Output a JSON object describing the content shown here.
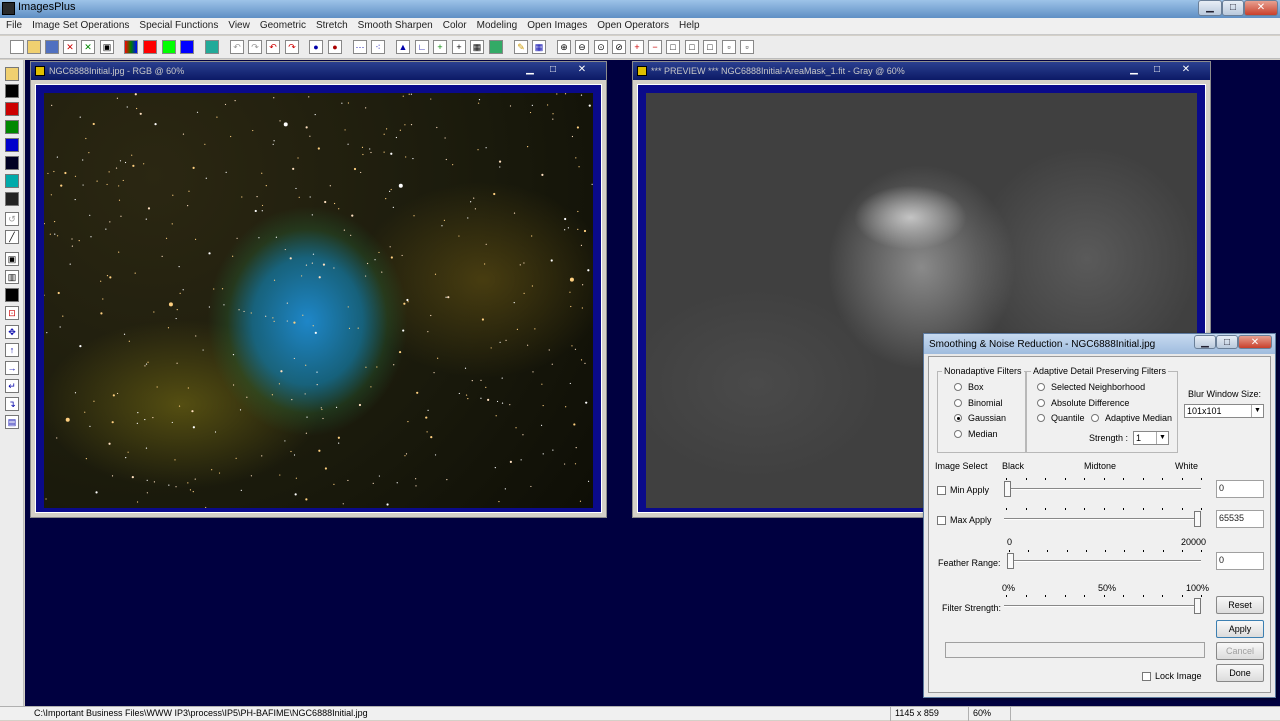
{
  "app": {
    "title": "ImagesPlus"
  },
  "menu": [
    "File",
    "Image Set Operations",
    "Special Functions",
    "View",
    "Geometric",
    "Stretch",
    "Smooth Sharpen",
    "Color",
    "Modeling",
    "Open Images",
    "Open Operators",
    "Help"
  ],
  "window_rgb": {
    "title": "NGC6888Initial.jpg - RGB @ 60%"
  },
  "window_preview": {
    "title": "*** PREVIEW *** NGC6888Initial-AreaMask_1.fit - Gray @ 60%"
  },
  "dialog": {
    "title": "Smoothing & Noise Reduction - NGC6888Initial.jpg",
    "nonadaptive_label": "Nonadaptive Filters",
    "nonadaptive": [
      "Box",
      "Binomial",
      "Gaussian",
      "Median"
    ],
    "nonadaptive_selected": "Gaussian",
    "adaptive_label": "Adaptive Detail Preserving Filters",
    "adaptive": {
      "selected_neighborhood": "Selected Neighborhood",
      "absolute_difference": "Absolute Difference",
      "quantile": "Quantile",
      "adaptive_median": "Adaptive Median"
    },
    "strength_label": "Strength :",
    "strength_value": "1",
    "blur_label": "Blur Window Size:",
    "blur_value": "101x101",
    "image_select": "Image Select",
    "black": "Black",
    "midtone": "Midtone",
    "white": "White",
    "min_apply": "Min Apply",
    "min_value": "0",
    "min_level": 0,
    "max_apply": "Max Apply",
    "max_value": "65535",
    "max_level": 1,
    "feather_min": "0",
    "feather_max": "20000",
    "feather_label": "Feather Range:",
    "feather_value": "0",
    "feather_level": 0,
    "pct0": "0%",
    "pct50": "50%",
    "pct100": "100%",
    "filter_strength": "Filter Strength:",
    "filter_level": 1,
    "reset": "Reset",
    "apply": "Apply",
    "cancel": "Cancel",
    "lock_image": "Lock Image",
    "done": "Done"
  },
  "status": {
    "path": "C:\\Important Business Files\\WWW IP3\\process\\IP5\\PH-BAFIME\\NGC6888Initial.jpg",
    "size": "1145 x 859",
    "zoom": "60%"
  },
  "colors": {
    "workspace": "#000040",
    "frame": "#0a0a8a"
  }
}
